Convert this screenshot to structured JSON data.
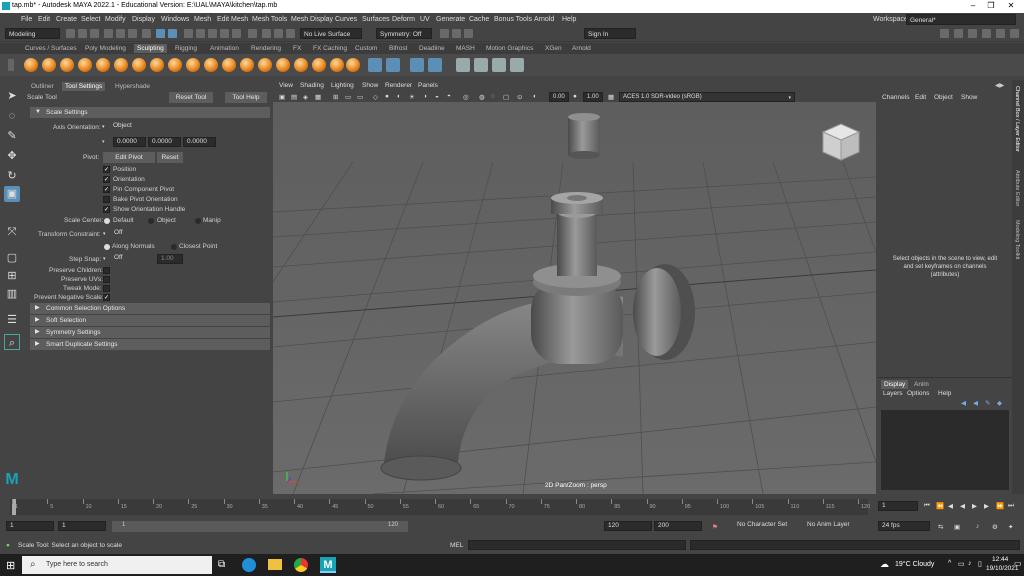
{
  "window": {
    "title": "tap.mb* - Autodesk MAYA 2022.1 - Educational Version: E:\\UAL\\MAYA\\kitchen\\tap.mb"
  },
  "menubar": {
    "items": [
      "File",
      "Edit",
      "Create",
      "Select",
      "Modify",
      "Display",
      "Windows",
      "Mesh",
      "Edit Mesh",
      "Mesh Tools",
      "Mesh Display",
      "Curves",
      "Surfaces",
      "Deform",
      "UV",
      "Generate",
      "Cache",
      "Bonus Tools",
      "Arnold",
      "Help"
    ],
    "workspace_label": "Workspace:",
    "workspace_value": "General*"
  },
  "statusline": {
    "mode": "Modeling",
    "live_surface": "No Live Surface",
    "symmetry": "Symmetry: Off",
    "sign_in": "Sign In"
  },
  "shelf": {
    "tabs": [
      "Curves / Surfaces",
      "Poly Modeling",
      "Sculpting",
      "Rigging",
      "Animation",
      "Rendering",
      "FX",
      "FX Caching",
      "Custom",
      "Bifrost",
      "Deadline",
      "MASH",
      "Motion Graphics",
      "XGen",
      "Arnold"
    ],
    "active_tab": "Sculpting"
  },
  "panel": {
    "tabs": [
      "Outliner",
      "Tool Settings",
      "Hypershade"
    ],
    "active_tab": "Tool Settings",
    "tool_name": "Scale Tool",
    "reset_tool": "Reset Tool",
    "tool_help": "Tool Help",
    "sections": {
      "scale_settings": "Scale Settings",
      "common_selection": "Common Selection Options",
      "soft_selection": "Soft Selection",
      "symmetry_settings": "Symmetry Settings",
      "smart_duplicate": "Smart Duplicate Settings"
    },
    "axis_orientation_label": "Axis Orientation:",
    "axis_orientation_value": "Object",
    "axis_values": [
      "0.0000",
      "0.0000",
      "0.0000"
    ],
    "pivot_label": "Pivot:",
    "edit_pivot": "Edit Pivot",
    "reset": "Reset",
    "pivot_checks": [
      {
        "label": "Position",
        "checked": true
      },
      {
        "label": "Orientation",
        "checked": true
      },
      {
        "label": "Pin Component Pivot",
        "checked": true
      },
      {
        "label": "Bake Pivot Orientation",
        "checked": false
      },
      {
        "label": "Show Orientation Handle",
        "checked": true
      }
    ],
    "scale_center_label": "Scale Center:",
    "scale_center_options": [
      "Default",
      "Object",
      "Manip"
    ],
    "transform_constraint_label": "Transform Constraint:",
    "transform_constraint_value": "Off",
    "constraint_options": [
      "Along Normals",
      "Closest Point"
    ],
    "step_snap_label": "Step Snap:",
    "step_snap_value": "Off",
    "step_snap_number": "1.00",
    "preserve_children": "Preserve Children:",
    "preserve_uvs": "Preserve UVs:",
    "tweak_mode": "Tweak Mode:",
    "prevent_negative_scale": "Prevent Negative Scale:"
  },
  "viewport": {
    "menus": [
      "View",
      "Shading",
      "Lighting",
      "Show",
      "Renderer",
      "Panels"
    ],
    "field1": "0.00",
    "field2": "1.00",
    "colorspace": "ACES 1.0 SDR-video (sRGB)",
    "hud": "2D Pan/Zoom : persp"
  },
  "channelbox": {
    "menus": [
      "Channels",
      "Edit",
      "Object",
      "Show"
    ],
    "message": "Select objects in the scene to view, edit and set keyframes on channels (attributes)",
    "layer_tabs": [
      "Display",
      "Anim"
    ],
    "layer_menus": [
      "Layers",
      "Options",
      "Help"
    ]
  },
  "sidetabs": [
    "Channel Box / Layer Editor",
    "Attribute Editor",
    "Modeling Toolkit"
  ],
  "timeline": {
    "ticks": [
      "1",
      "5",
      "10",
      "15",
      "20",
      "25",
      "30",
      "35",
      "40",
      "45",
      "50",
      "55",
      "60",
      "65",
      "70",
      "75",
      "80",
      "85",
      "90",
      "95",
      "100",
      "105",
      "110",
      "115",
      "120"
    ],
    "current_frame": "1"
  },
  "range": {
    "start": "1",
    "start2": "1",
    "slider_start": "1",
    "slider_end": "120",
    "end": "120",
    "end2": "200",
    "character_set": "No Character Set",
    "anim_layer": "No Anim Layer",
    "fps": "24 fps"
  },
  "cmdline": {
    "help": "Scale Tool: Select an object to scale",
    "mel": "MEL"
  },
  "taskbar": {
    "search_placeholder": "Type here to search",
    "weather": "19°C  Cloudy",
    "time": "12:44",
    "date": "19/10/2021"
  }
}
